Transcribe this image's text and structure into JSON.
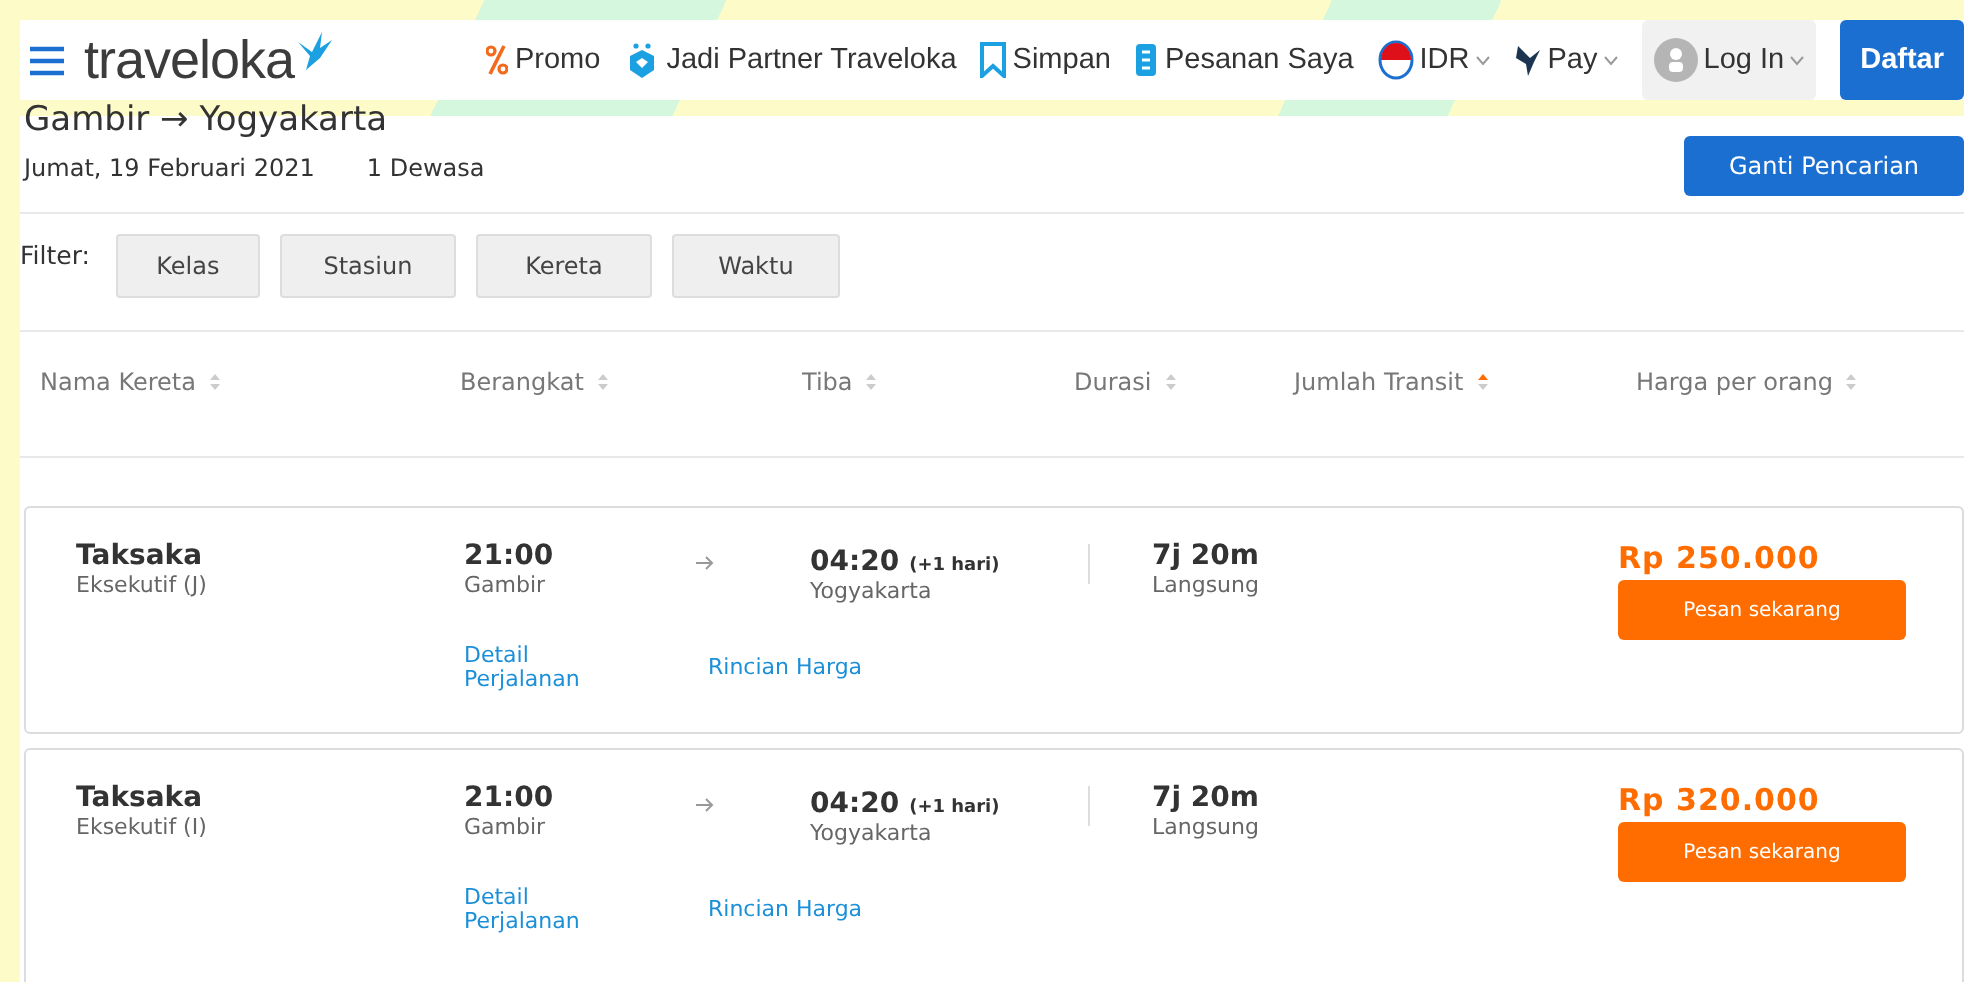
{
  "header": {
    "logo": "traveloka",
    "nav": [
      {
        "kind": "promo",
        "label": "Promo"
      },
      {
        "kind": "partner",
        "label": "Jadi Partner Traveloka"
      },
      {
        "kind": "bookmark",
        "label": "Simpan"
      },
      {
        "kind": "orders",
        "label": "Pesanan Saya"
      },
      {
        "kind": "currency",
        "label": "IDR"
      },
      {
        "kind": "pay",
        "label": "Pay"
      },
      {
        "kind": "login",
        "label": "Log In"
      },
      {
        "kind": "register",
        "label": "Daftar"
      }
    ]
  },
  "search": {
    "route": "Gambir → Yogyakarta",
    "date": "Jumat, 19 Februari 2021",
    "passengers": "1 Dewasa",
    "change_button": "Ganti Pencarian"
  },
  "filter": {
    "label": "Filter:",
    "buttons": [
      "Kelas",
      "Stasiun",
      "Kereta",
      "Waktu"
    ]
  },
  "table": {
    "columns": [
      {
        "label": "Nama Kereta",
        "sorted": false
      },
      {
        "label": "Berangkat",
        "sorted": false
      },
      {
        "label": "Tiba",
        "sorted": false
      },
      {
        "label": "Durasi",
        "sorted": false
      },
      {
        "label": "Jumlah Transit",
        "sorted": true
      },
      {
        "label": "Harga per orang",
        "sorted": false
      }
    ],
    "rows": [
      {
        "name": "Taksaka",
        "class": "Eksekutif (J)",
        "depart_time": "21:00",
        "depart_station": "Gambir",
        "arrive_time": "04:20",
        "arrive_note": "(+1 hari)",
        "arrive_station": "Yogyakarta",
        "duration": "7j 20m",
        "transit": "Langsung",
        "price": "Rp 250.000",
        "book_button": "Pesan sekarang",
        "links": [
          "Detail Perjalanan",
          "Rincian Harga"
        ]
      },
      {
        "name": "Taksaka",
        "class": "Eksekutif (I)",
        "depart_time": "21:00",
        "depart_station": "Gambir",
        "arrive_time": "04:20",
        "arrive_note": "(+1 hari)",
        "arrive_station": "Yogyakarta",
        "duration": "7j 20m",
        "transit": "Langsung",
        "price": "Rp 320.000",
        "book_button": "Pesan sekarang",
        "links": [
          "Detail Perjalanan",
          "Rincian Harga"
        ]
      }
    ]
  }
}
